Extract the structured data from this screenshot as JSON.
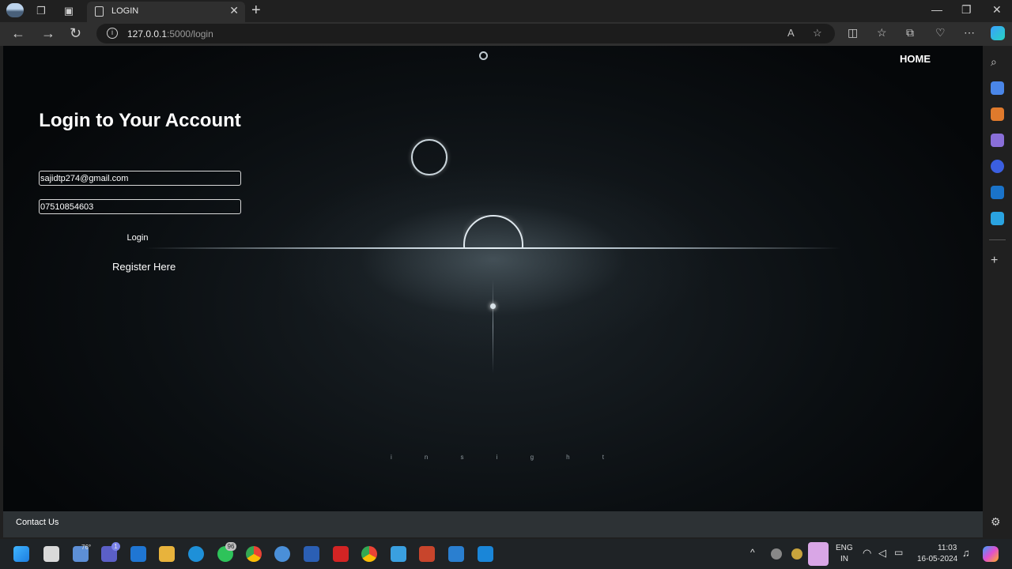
{
  "browser": {
    "tab_title": "LOGIN",
    "url_host": "127.0.0.1",
    "url_path": ":5000/login"
  },
  "page": {
    "nav_home": "HOME",
    "login": {
      "heading": "Login to Your Account",
      "email_value": "sajidtp274@gmail.com",
      "password_value": "07510854603",
      "login_button": "Login",
      "register_link": "Register Here"
    },
    "background_letters": [
      "i",
      "n",
      "s",
      "i",
      "g",
      "h",
      "t"
    ],
    "footer_contact": "Contact Us"
  },
  "taskbar": {
    "weather": "76°",
    "teams_badge": "1",
    "whatsapp_badge": "96",
    "lang_top": "ENG",
    "lang_bottom": "IN",
    "time": "11:03",
    "date": "16-05-2024"
  },
  "colors": {
    "page_dark": "#0b0f12",
    "footer": "#2d3235",
    "text": "#ffffff"
  }
}
